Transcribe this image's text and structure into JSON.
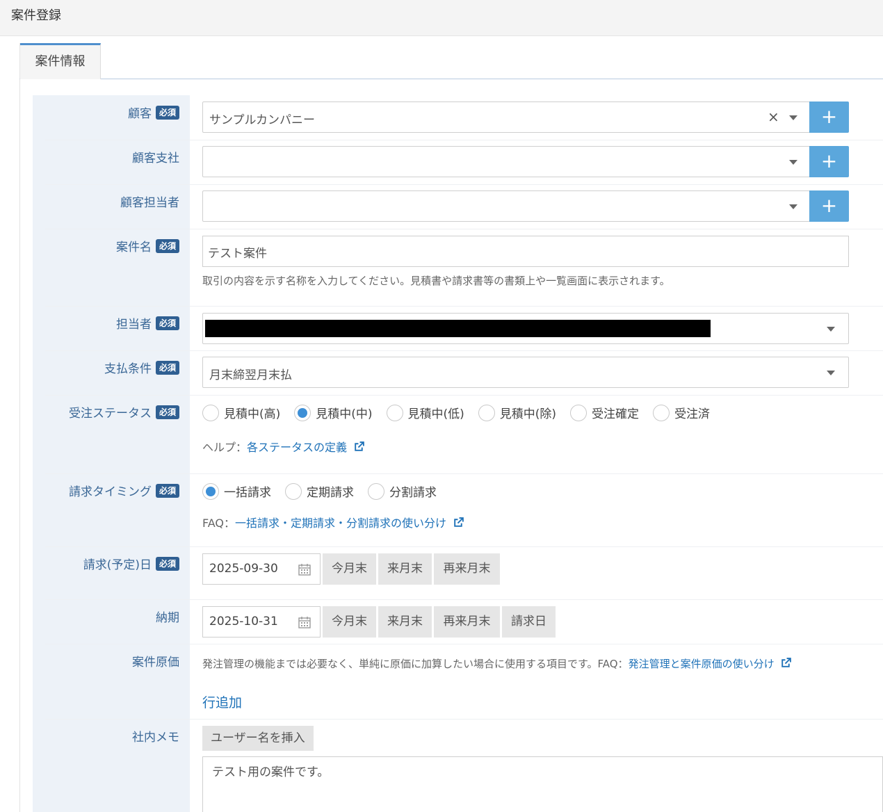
{
  "page": {
    "title": "案件登録"
  },
  "tabs": [
    {
      "label": "案件情報",
      "active": true
    }
  ],
  "required_badge": "必須",
  "fields": {
    "customer": {
      "label": "顧客",
      "value": "サンプルカンパニー",
      "clear": "×",
      "add": "+"
    },
    "customer_branch": {
      "label": "顧客支社",
      "value": "",
      "add": "+"
    },
    "customer_contact": {
      "label": "顧客担当者",
      "value": "",
      "add": "+"
    },
    "project_name": {
      "label": "案件名",
      "value": "テスト案件",
      "help": "取引の内容を示す名称を入力してください。見積書や請求書等の書類上や一覧画面に表示されます。"
    },
    "owner": {
      "label": "担当者"
    },
    "payment_terms": {
      "label": "支払条件",
      "value": "月末締翌月末払"
    },
    "order_status": {
      "label": "受注ステータス",
      "options": [
        "見積中(高)",
        "見積中(中)",
        "見積中(低)",
        "見積中(除)",
        "受注確定",
        "受注済"
      ],
      "selected": "見積中(中)",
      "help_prefix": "ヘルプ：",
      "help_link": "各ステータスの定義"
    },
    "billing_timing": {
      "label": "請求タイミング",
      "options": [
        "一括請求",
        "定期請求",
        "分割請求"
      ],
      "selected": "一括請求",
      "faq_prefix": "FAQ：",
      "faq_link": "一括請求・定期請求・分割請求の使い分け"
    },
    "billing_date": {
      "label": "請求(予定)日",
      "value": "2025-09-30",
      "buttons": [
        "今月末",
        "来月末",
        "再来月末"
      ]
    },
    "delivery_date": {
      "label": "納期",
      "value": "2025-10-31",
      "buttons": [
        "今月末",
        "来月末",
        "再来月末",
        "請求日"
      ]
    },
    "project_cost": {
      "label": "案件原価",
      "help": "発注管理の機能までは必要なく、単純に原価に加算したい場合に使用する項目です。FAQ：",
      "help_link": "発注管理と案件原価の使い分け",
      "add_row": "行追加"
    },
    "internal_memo": {
      "label": "社内メモ",
      "insert_button": "ユーザー名を挿入",
      "value": "テスト用の案件です。"
    }
  }
}
